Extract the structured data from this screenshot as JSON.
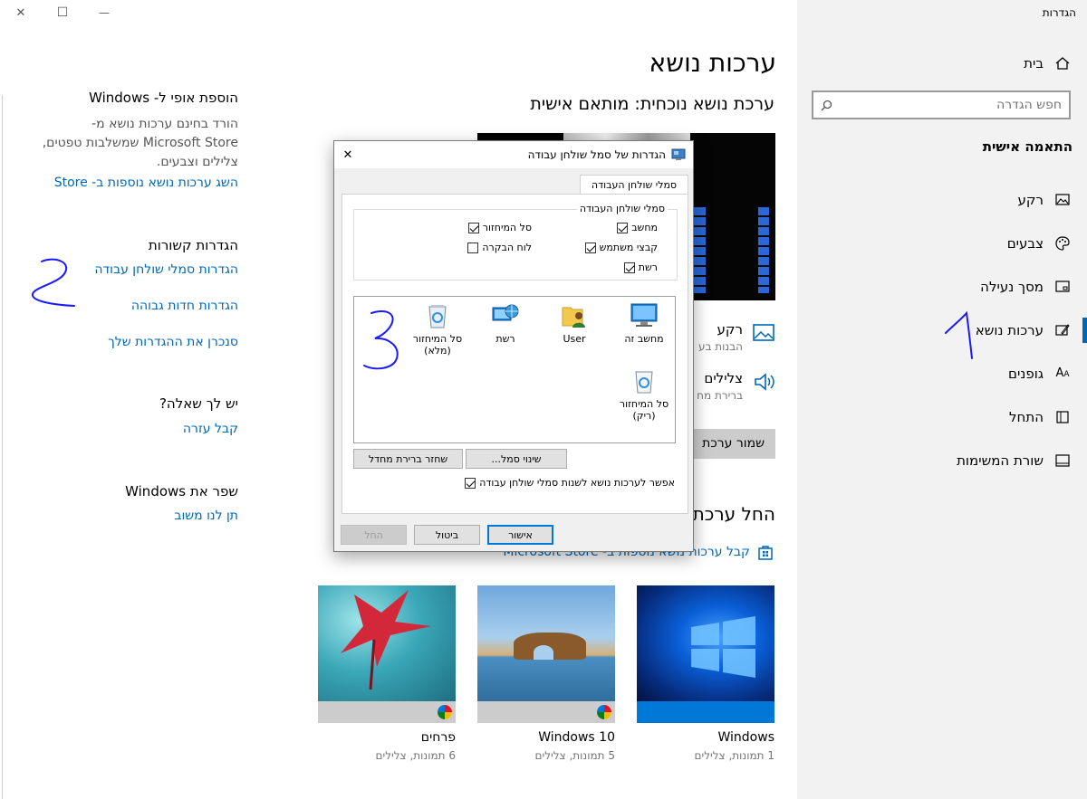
{
  "window": {
    "title": "הגדרות",
    "minimize_glyph": "—",
    "maximize_glyph": "☐",
    "close_glyph": "✕"
  },
  "nav": {
    "home": "בית",
    "search_placeholder": "חפש הגדרה",
    "section_title": "התאמה אישית",
    "items": [
      {
        "label": "רקע",
        "icon": "image-icon"
      },
      {
        "label": "צבעים",
        "icon": "palette-icon"
      },
      {
        "label": "מסך נעילה",
        "icon": "lock-screen-icon"
      },
      {
        "label": "ערכות נושא",
        "icon": "themes-icon",
        "selected": true
      },
      {
        "label": "גופנים",
        "icon": "fonts-icon"
      },
      {
        "label": "התחל",
        "icon": "start-icon"
      },
      {
        "label": "שורת המשימות",
        "icon": "taskbar-icon"
      }
    ]
  },
  "main": {
    "page_title": "ערכות נושא",
    "current_theme": "ערכת נושא נוכחית: מותאם אישית",
    "background_label": "רקע",
    "background_sub": "הבנות בע",
    "sounds_label": "צלילים",
    "sounds_sub": "ברירת מח",
    "save_theme": "שמור ערכת",
    "apply_theme_heading": "החל ערכת",
    "store_link": "קבל ערכות נושא נוספות ב- Microsoft Store",
    "themes": [
      {
        "name": "Windows",
        "sub": "1 תמונות, צלילים"
      },
      {
        "name": "Windows 10",
        "sub": "5 תמונות, צלילים"
      },
      {
        "name": "פרחים",
        "sub": "6 תמונות, צלילים"
      }
    ]
  },
  "side": {
    "unique_title": "הוספת אופי ל- Windows",
    "unique_text": "הורד בחינם ערכות נושא מ- Microsoft Store שמשלבות טפטים, צלילים וצבעים.",
    "unique_link": "השג ערכות נושא נוספות ב- Store",
    "related_title": "הגדרות קשורות",
    "related_links": [
      "הגדרות סמלי שולחן עבודה",
      "הגדרות חדות גבוהה",
      "סנכרן את ההגדרות שלך"
    ],
    "question_title": "יש לך שאלה?",
    "question_link": "קבל עזרה",
    "improve_title": "שפר את Windows",
    "improve_link": "תן לנו משוב"
  },
  "dialog": {
    "title": "הגדרות של סמל שולחן עבודה",
    "close_glyph": "✕",
    "tab": "סמלי שולחן העבודה",
    "group_title": "סמלי שולחן העבודה",
    "checkboxes": [
      {
        "label": "מחשב",
        "checked": true
      },
      {
        "label": "סל המיחזור",
        "checked": true
      },
      {
        "label": "קבצי משתמש",
        "checked": true
      },
      {
        "label": "לוח הבקרה",
        "checked": false
      },
      {
        "label": "רשת",
        "checked": true
      }
    ],
    "icons": [
      {
        "label": "מחשב זה",
        "icon": "computer-icon"
      },
      {
        "label": "User",
        "icon": "user-folder-icon"
      },
      {
        "label": "רשת",
        "icon": "network-icon"
      },
      {
        "label": "סל המיחזור (מלא)",
        "icon": "recycle-bin-full-icon"
      },
      {
        "label": "סל המיחזור (ריק)",
        "icon": "recycle-bin-empty-icon"
      }
    ],
    "change_icon": "שינוי סמל...",
    "restore_default": "שחזר ברירת מחדל",
    "allow_themes": "אפשר לערכות נושא לשנות סמלי שולחן עבודה",
    "allow_themes_checked": true,
    "ok": "אישור",
    "cancel": "ביטול",
    "apply": "החל"
  },
  "annotations": [
    "1",
    "2",
    "3"
  ],
  "colors": {
    "accent": "#0067b8",
    "nav_bg": "#f2f2f2",
    "annotation_ink": "#1a1aff"
  }
}
